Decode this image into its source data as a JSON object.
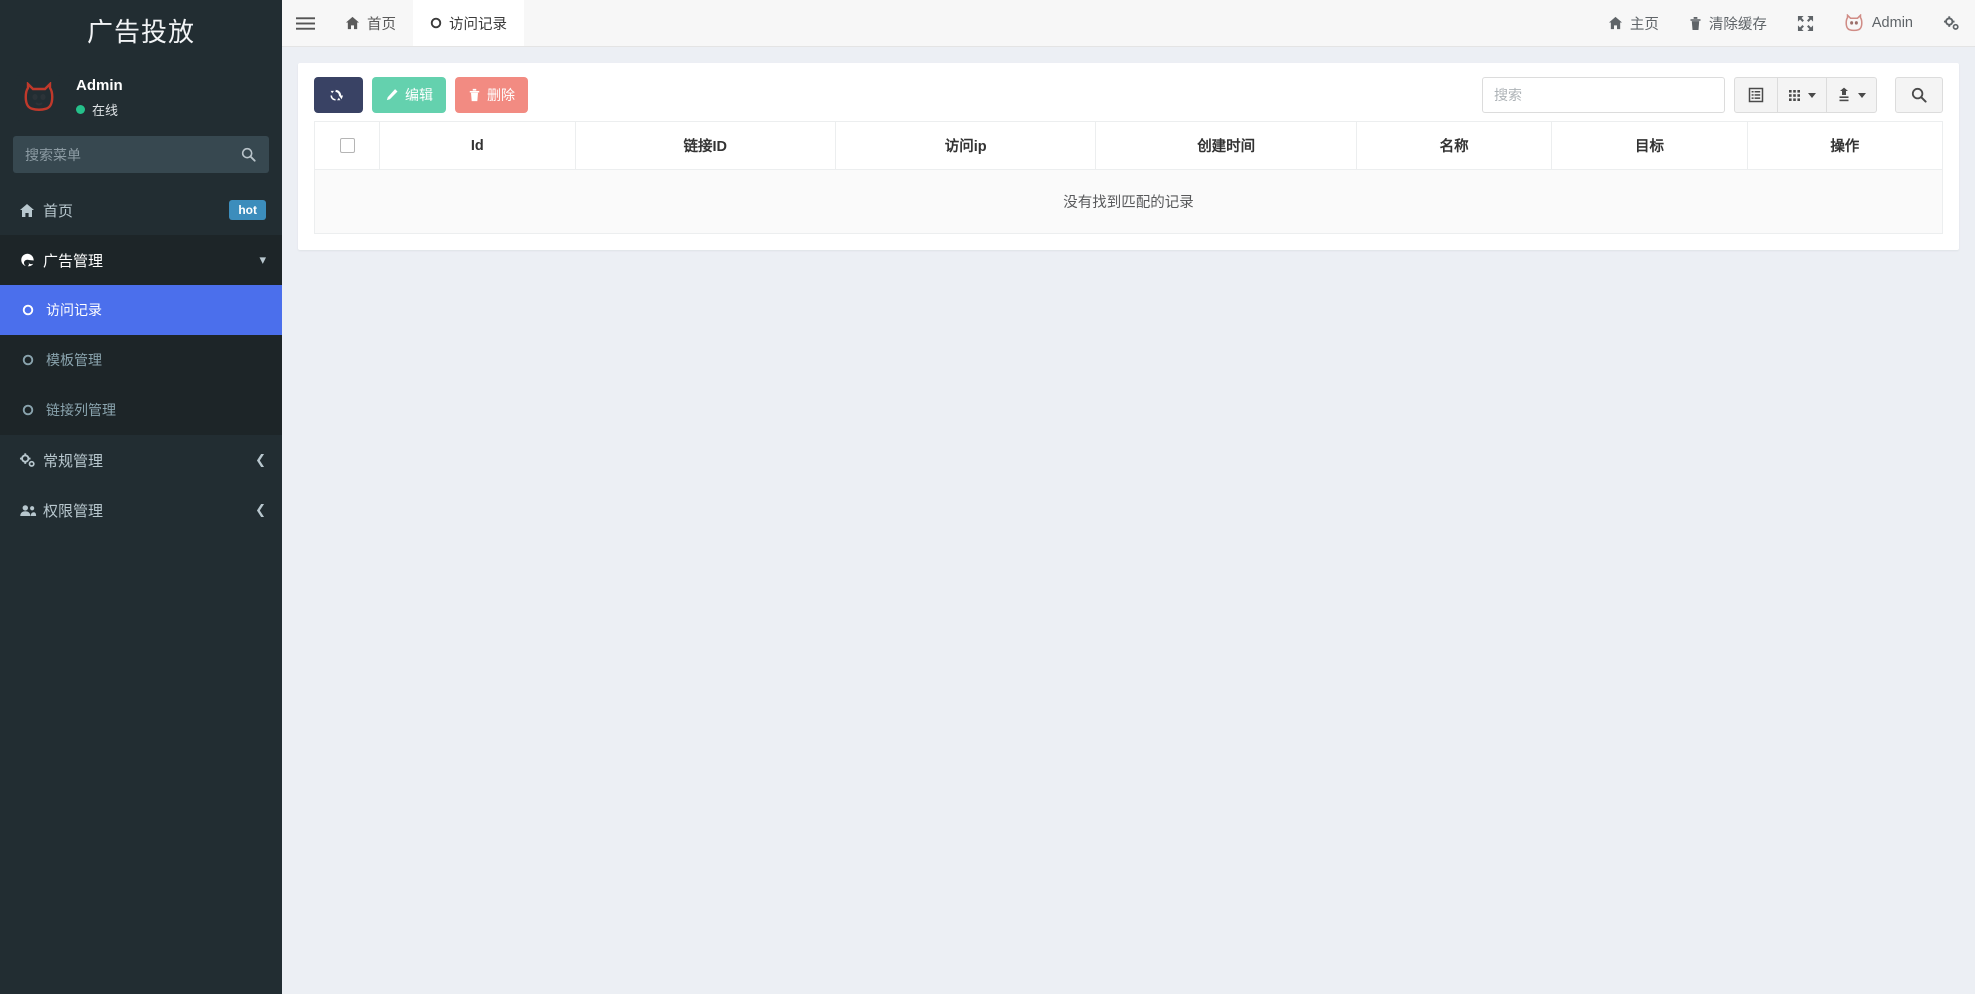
{
  "sidebar": {
    "brand_title": "广告投放",
    "user": {
      "name": "Admin",
      "status": "在线",
      "avatar_icon": "cat-logo-icon"
    },
    "search": {
      "placeholder": "搜索菜单",
      "icon": "search-icon"
    },
    "menu": [
      {
        "label": "首页",
        "icon": "home-icon",
        "badge": "hot",
        "type": "link"
      },
      {
        "label": "广告管理",
        "icon": "edge-browser-icon",
        "type": "parent-open",
        "caret": "chevron-down-icon"
      },
      {
        "label": "常规管理",
        "icon": "gears-icon",
        "type": "parent",
        "caret": "chevron-left-icon"
      },
      {
        "label": "权限管理",
        "icon": "users-icon",
        "type": "parent",
        "caret": "chevron-left-icon"
      }
    ],
    "submenu": [
      {
        "label": "访问记录",
        "icon": "circle-icon",
        "active": true
      },
      {
        "label": "模板管理",
        "icon": "circle-icon",
        "active": false
      },
      {
        "label": "链接列管理",
        "icon": "circle-icon",
        "active": false
      }
    ]
  },
  "topbar": {
    "menu_toggle_icon": "hamburger-icon",
    "tabs": [
      {
        "label": "首页",
        "icon": "home-icon",
        "active": false
      },
      {
        "label": "访问记录",
        "icon": "circle-icon",
        "active": true
      }
    ],
    "right_items": [
      {
        "label": "主页",
        "icon": "home-icon"
      },
      {
        "label": "清除缓存",
        "icon": "trash-icon"
      },
      {
        "label": "",
        "icon": "fullscreen-expand-icon"
      },
      {
        "label": "Admin",
        "icon": "cat-avatar-icon"
      },
      {
        "label": "",
        "icon": "gear-icon"
      }
    ]
  },
  "toolbar": {
    "refresh_label": "",
    "refresh_icon": "refresh-icon",
    "edit_label": "编辑",
    "edit_icon": "pencil-icon",
    "edit_color": "#64d1ae",
    "delete_label": "删除",
    "delete_icon": "trash-icon",
    "delete_color": "#f28b82",
    "search_placeholder": "搜索",
    "search_value": "",
    "icons": {
      "columns_toggle": "list-alt-icon",
      "grid_view": "grid-icon",
      "export": "export-icon",
      "search_submit": "search-icon"
    }
  },
  "table": {
    "columns": [
      "",
      "Id",
      "链接ID",
      "访问ip",
      "创建时间",
      "名称",
      "目标",
      "操作"
    ],
    "rows": [],
    "empty_message": "没有找到匹配的记录"
  },
  "colors": {
    "sidebar_bg": "#222d32",
    "sidebar_submenu_bg": "#1d2528",
    "active_menu": "#4b6fec",
    "badge_hot": "#3c8dbc",
    "content_bg": "#eceff4",
    "refresh_btn": "#394264"
  }
}
